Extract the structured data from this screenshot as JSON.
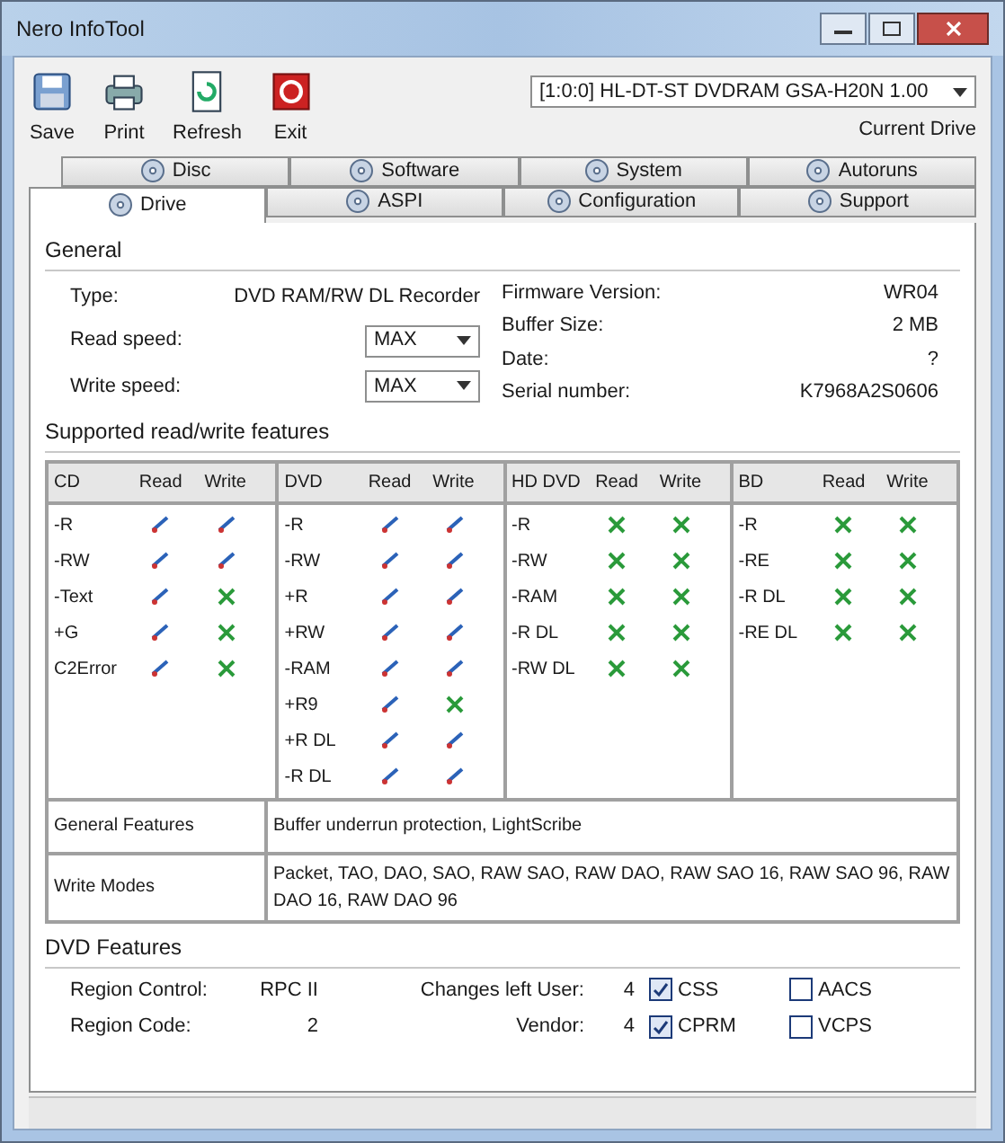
{
  "window": {
    "title": "Nero InfoTool"
  },
  "toolbar": [
    {
      "label": "Save"
    },
    {
      "label": "Print"
    },
    {
      "label": "Refresh"
    },
    {
      "label": "Exit"
    }
  ],
  "drive_select": {
    "value": "[1:0:0] HL-DT-ST DVDRAM GSA-H20N  1.00",
    "label": "Current Drive"
  },
  "tabs_top": [
    {
      "label": "Disc",
      "selected": false
    },
    {
      "label": "Software",
      "selected": false
    },
    {
      "label": "System",
      "selected": false
    },
    {
      "label": "Autoruns",
      "selected": false
    }
  ],
  "tabs_bottom": [
    {
      "label": "Drive",
      "selected": true
    },
    {
      "label": "ASPI",
      "selected": false
    },
    {
      "label": "Configuration",
      "selected": false
    },
    {
      "label": "Support",
      "selected": false
    }
  ],
  "general": {
    "title": "General",
    "type_label": "Type:",
    "type_value": "DVD RAM/RW DL Recorder",
    "read_label": "Read speed:",
    "read_value": "MAX",
    "write_label": "Write speed:",
    "write_value": "MAX",
    "right": [
      {
        "label": "Firmware Version:",
        "value": "WR04"
      },
      {
        "label": "Buffer Size:",
        "value": "2 MB"
      },
      {
        "label": "Date:",
        "value": "?"
      },
      {
        "label": "Serial number:",
        "value": "K7968A2S0606"
      }
    ]
  },
  "features_title": "Supported read/write features",
  "formats": [
    {
      "name": "CD",
      "read": "Read",
      "write": "Write",
      "rows": [
        {
          "label": "-R",
          "read": true,
          "write": true
        },
        {
          "label": "-RW",
          "read": true,
          "write": true
        },
        {
          "label": "-Text",
          "read": true,
          "write": false
        },
        {
          "label": "+G",
          "read": true,
          "write": false
        },
        {
          "label": "C2Error",
          "read": true,
          "write": false
        }
      ]
    },
    {
      "name": "DVD",
      "read": "Read",
      "write": "Write",
      "rows": [
        {
          "label": "-R",
          "read": true,
          "write": true
        },
        {
          "label": "-RW",
          "read": true,
          "write": true
        },
        {
          "label": "+R",
          "read": true,
          "write": true
        },
        {
          "label": "+RW",
          "read": true,
          "write": true
        },
        {
          "label": "-RAM",
          "read": true,
          "write": true
        },
        {
          "label": "+R9",
          "read": true,
          "write": false
        },
        {
          "label": "+R DL",
          "read": true,
          "write": true
        },
        {
          "label": "-R DL",
          "read": true,
          "write": true
        }
      ]
    },
    {
      "name": "HD DVD",
      "read": "Read",
      "write": "Write",
      "rows": [
        {
          "label": "-R",
          "read": false,
          "write": false
        },
        {
          "label": "-RW",
          "read": false,
          "write": false
        },
        {
          "label": "-RAM",
          "read": false,
          "write": false
        },
        {
          "label": "-R DL",
          "read": false,
          "write": false
        },
        {
          "label": "-RW DL",
          "read": false,
          "write": false
        }
      ]
    },
    {
      "name": "BD",
      "read": "Read",
      "write": "Write",
      "rows": [
        {
          "label": "-R",
          "read": false,
          "write": false
        },
        {
          "label": "-RE",
          "read": false,
          "write": false
        },
        {
          "label": "-R DL",
          "read": false,
          "write": false
        },
        {
          "label": "-RE DL",
          "read": false,
          "write": false
        }
      ]
    }
  ],
  "info_rows": [
    {
      "label": "General Features",
      "value": "Buffer underrun protection, LightScribe"
    },
    {
      "label": "Write Modes",
      "value": "Packet, TAO, DAO, SAO, RAW SAO, RAW DAO, RAW SAO 16, RAW SAO 96, RAW DAO 16, RAW DAO 96"
    }
  ],
  "dvd": {
    "title": "DVD Features",
    "region_control_label": "Region Control:",
    "region_control": "RPC II",
    "region_code_label": "Region Code:",
    "region_code": "2",
    "changes_user_label": "Changes left User:",
    "changes_user": "4",
    "vendor_label": "Vendor:",
    "vendor": "4",
    "flags": [
      {
        "label": "CSS",
        "checked": true
      },
      {
        "label": "AACS",
        "checked": false
      },
      {
        "label": "CPRM",
        "checked": true
      },
      {
        "label": "VCPS",
        "checked": false
      }
    ]
  }
}
